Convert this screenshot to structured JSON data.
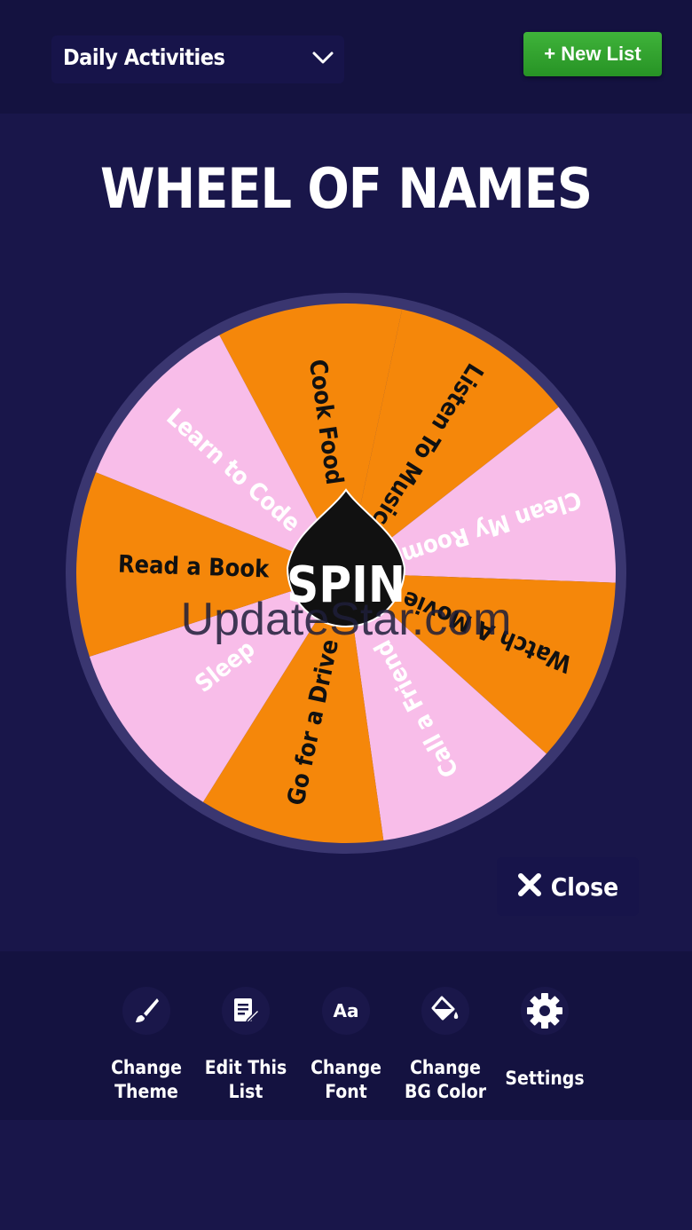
{
  "header": {
    "list_name": "Daily Activities",
    "new_list_label": "+ New List"
  },
  "title": "WHEEL OF NAMES",
  "wheel": {
    "spin_label": "SPIN",
    "colors": {
      "orange": "#f5870a",
      "pink": "#f8bde9",
      "rim": "#3a3670",
      "hub": "#111111"
    },
    "segments": [
      {
        "label": "Cook Food",
        "color": "orange",
        "text_color": "#111111"
      },
      {
        "label": "Listen To Music",
        "color": "orange",
        "text_color": "#111111"
      },
      {
        "label": "Clean My Room",
        "color": "pink",
        "text_color": "#ffffff"
      },
      {
        "label": "Watch A Movie",
        "color": "orange",
        "text_color": "#111111"
      },
      {
        "label": "Call a Friend",
        "color": "pink",
        "text_color": "#ffffff"
      },
      {
        "label": "Go for a Drive",
        "color": "orange",
        "text_color": "#111111"
      },
      {
        "label": "Sleep",
        "color": "pink",
        "text_color": "#ffffff"
      },
      {
        "label": "Read a Book",
        "color": "orange",
        "text_color": "#111111"
      },
      {
        "label": "Learn to Code",
        "color": "pink",
        "text_color": "#ffffff"
      }
    ]
  },
  "watermark": "UpdateStar.com",
  "close_label": "Close",
  "toolbar": {
    "items": [
      {
        "label": "Change\nTheme",
        "icon": "brush-icon"
      },
      {
        "label": "Edit This\nList",
        "icon": "edit-list-icon"
      },
      {
        "label": "Change\nFont",
        "icon": "font-icon"
      },
      {
        "label": "Change\nBG Color",
        "icon": "paint-bucket-icon"
      },
      {
        "label": "Settings",
        "icon": "gear-icon"
      }
    ]
  }
}
